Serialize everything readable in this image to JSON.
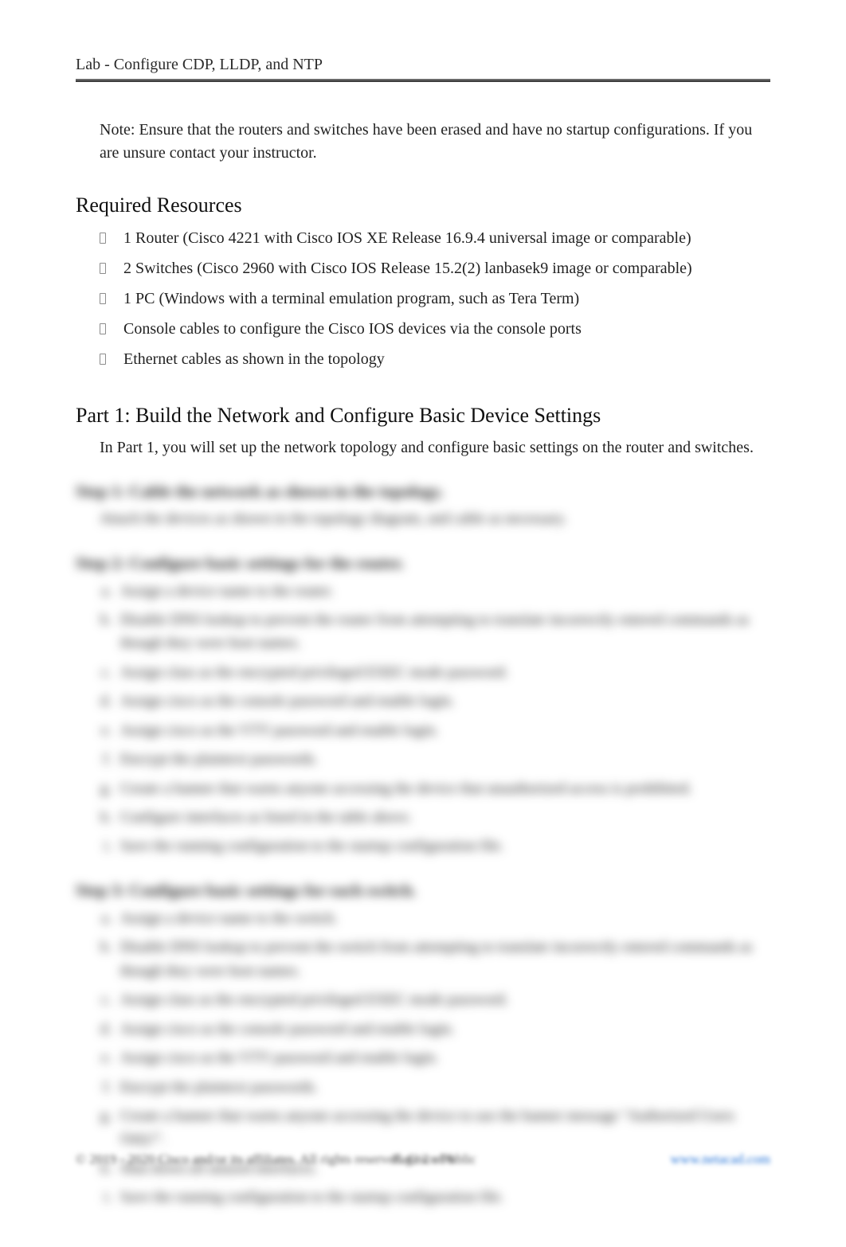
{
  "doc": {
    "title": "Lab - Configure CDP, LLDP, and NTP"
  },
  "note": {
    "prefix": "Note",
    "text": ": Ensure that the routers and switches have been erased and have no startup configurations. If you are unsure contact your instructor."
  },
  "resources": {
    "heading": "Required Resources",
    "items": [
      "1 Router (Cisco 4221 with Cisco IOS XE Release 16.9.4 universal image or comparable)",
      "2 Switches (Cisco 2960 with Cisco IOS Release 15.2(2) lanbasek9 image or comparable)",
      "1 PC (Windows with a terminal emulation program, such as Tera Term)",
      "Console cables to configure the Cisco IOS devices via the console ports",
      "Ethernet cables as shown in the topology"
    ]
  },
  "part1": {
    "heading": "Part 1: Build the Network and Configure Basic Device Settings",
    "intro": "In Part 1, you will set up the network topology and configure basic settings on the router and switches."
  },
  "steps": {
    "step1": {
      "heading": "Step 1: Cable the network as shown in the topology.",
      "body": "Attach the devices as shown in the topology diagram, and cable as necessary."
    },
    "step2": {
      "heading": "Step 2: Configure basic settings for the router.",
      "items": [
        "Assign a device name to the router.",
        "Disable DNS lookup to prevent the router from attempting to translate incorrectly entered commands as though they were host names.",
        "Assign class as the encrypted privileged EXEC mode password.",
        "Assign cisco as the console password and enable login.",
        "Assign cisco as the VTY password and enable login.",
        "Encrypt the plaintext passwords.",
        "Create a banner that warns anyone accessing the device that unauthorized access is prohibited.",
        "Configure interfaces as listed in the table above.",
        "Save the running configuration to the startup configuration file."
      ]
    },
    "step3": {
      "heading": "Step 3: Configure basic settings for each switch.",
      "items": [
        "Assign a device name to the switch.",
        "Disable DNS lookup to prevent the switch from attempting to translate incorrectly entered commands as though they were host names.",
        "Assign class as the encrypted privileged EXEC mode password.",
        "Assign cisco as the console password and enable login.",
        "Assign cisco as the VTY password and enable login.",
        "Encrypt the plaintext passwords.",
        "Create a banner that warns anyone accessing the device to use the banner message \"Authorized Users Only!\".",
        "Shut down all unused interfaces.",
        "Save the running configuration to the startup configuration file."
      ]
    }
  },
  "footer": {
    "left": "© 2019 - 2020 Cisco and/or its affiliates. All rights reserved. Cisco Public",
    "center": "Page 2 of 8",
    "right_url": "www.netacad.com"
  }
}
